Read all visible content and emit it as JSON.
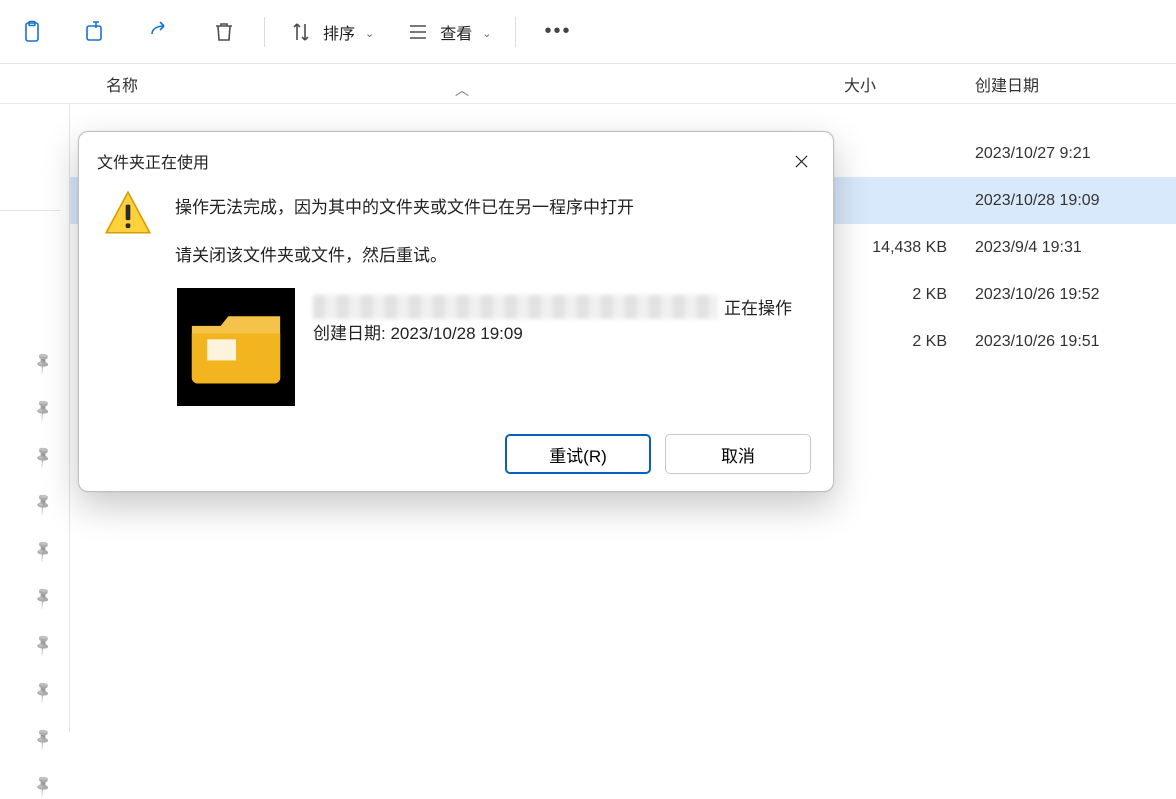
{
  "toolbar": {
    "sort_label": "排序",
    "view_label": "查看"
  },
  "columns": {
    "name": "名称",
    "size": "大小",
    "date": "创建日期"
  },
  "files": [
    {
      "name": "",
      "size": "",
      "date": "2023/10/27 9:21",
      "selected": false
    },
    {
      "name": "",
      "size": "",
      "date": "2023/10/28 19:09",
      "selected": true
    },
    {
      "name": "",
      "size": "14,438 KB",
      "date": "2023/9/4 19:31",
      "selected": false
    },
    {
      "name": "",
      "size": "2 KB",
      "date": "2023/10/26 19:52",
      "selected": false
    },
    {
      "name": "",
      "size": "2 KB",
      "date": "2023/10/26 19:51",
      "selected": false
    }
  ],
  "pins_count": 10,
  "dialog": {
    "title": "文件夹正在使用",
    "line1": "操作无法完成，因为其中的文件夹或文件已在另一程序中打开",
    "line2": "请关闭该文件夹或文件，然后重试。",
    "detail_suffix": "正在操作",
    "detail_date_label": "创建日期: ",
    "detail_date": "2023/10/28 19:09",
    "btn_retry": "重试(R)",
    "btn_cancel": "取消"
  }
}
